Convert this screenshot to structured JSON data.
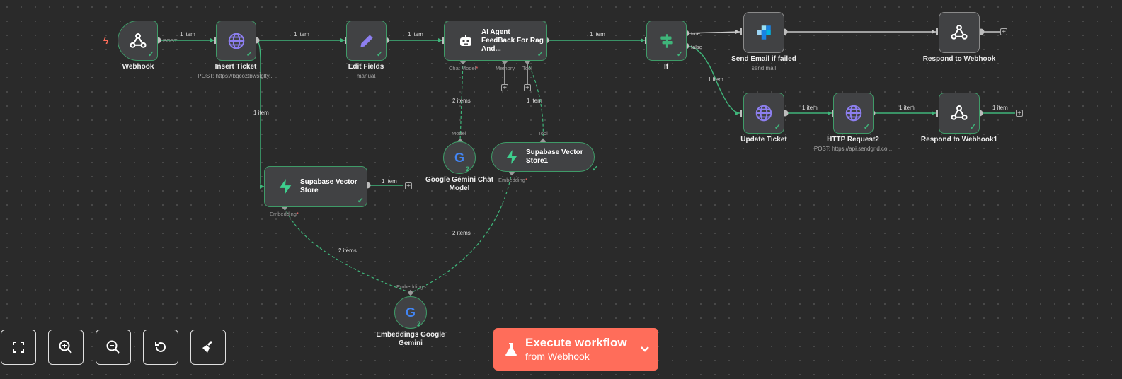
{
  "nodes": {
    "webhook": {
      "title": "Webhook"
    },
    "insert_ticket": {
      "title": "Insert Ticket",
      "subtitle": "POST: https://bqcoztbwsl̀glty..."
    },
    "edit_fields": {
      "title": "Edit Fields",
      "subtitle": "manual"
    },
    "ai_agent": {
      "title": "AI Agent FeedBack For Rag And..."
    },
    "if_node": {
      "title": "If"
    },
    "send_email": {
      "title": "Send Email if failed",
      "subtitle": "send:mail"
    },
    "respond_webhook": {
      "title": "Respond to Webhook"
    },
    "update_ticket": {
      "title": "Update Ticket"
    },
    "http_request2": {
      "title": "HTTP Request2",
      "subtitle": "POST: https://api.sendgrid.co..."
    },
    "respond_webhook1": {
      "title": "Respond to Webhook1"
    },
    "supabase_store": {
      "title": "Supabase Vector Store"
    },
    "supabase_store1": {
      "title": "Supabase Vector Store1"
    },
    "gemini_chat": {
      "title": "Google Gemini Chat Model",
      "count": "2"
    },
    "embeddings_gemini": {
      "title": "Embeddings Google Gemini",
      "count": "2"
    }
  },
  "edge_labels": {
    "webhook_insert": "1 item",
    "insert_edit": "1 item",
    "edit_agent": "1 item",
    "agent_if": "1 item",
    "insert_supabase": "1 item",
    "supabase_out": "1 item",
    "if_false_update": "1 item",
    "update_http": "1 item",
    "http_respond1": "1 item",
    "respond1_out": "1 item",
    "gemini_agent": "2 items",
    "store1_agent": "1 item",
    "emb_store": "2 items",
    "emb_store1": "2 items"
  },
  "ports": {
    "post": "POST",
    "true_label": "true",
    "false_label": "false",
    "chat_model": "Chat Model",
    "memory": "Memory",
    "tool": "Tool",
    "model": "Model",
    "tool_in": "Tool",
    "embedding": "Embedding",
    "embedding1": "Embedding",
    "embeddings_out": "Embeddings",
    "required_mark": "*"
  },
  "execute_button": {
    "line1": "Execute workflow",
    "line2": "from Webhook"
  },
  "controls": [
    "fit-view",
    "zoom-in",
    "zoom-out",
    "reset-zoom",
    "tidy-up"
  ],
  "colors": {
    "canvas": "#2a2a2a",
    "node_bg": "#414244",
    "success_border": "#3f9b68",
    "edge": "#3fb57a",
    "execute": "#ff6d5a",
    "trigger_bolt": "#ff6d5a"
  }
}
